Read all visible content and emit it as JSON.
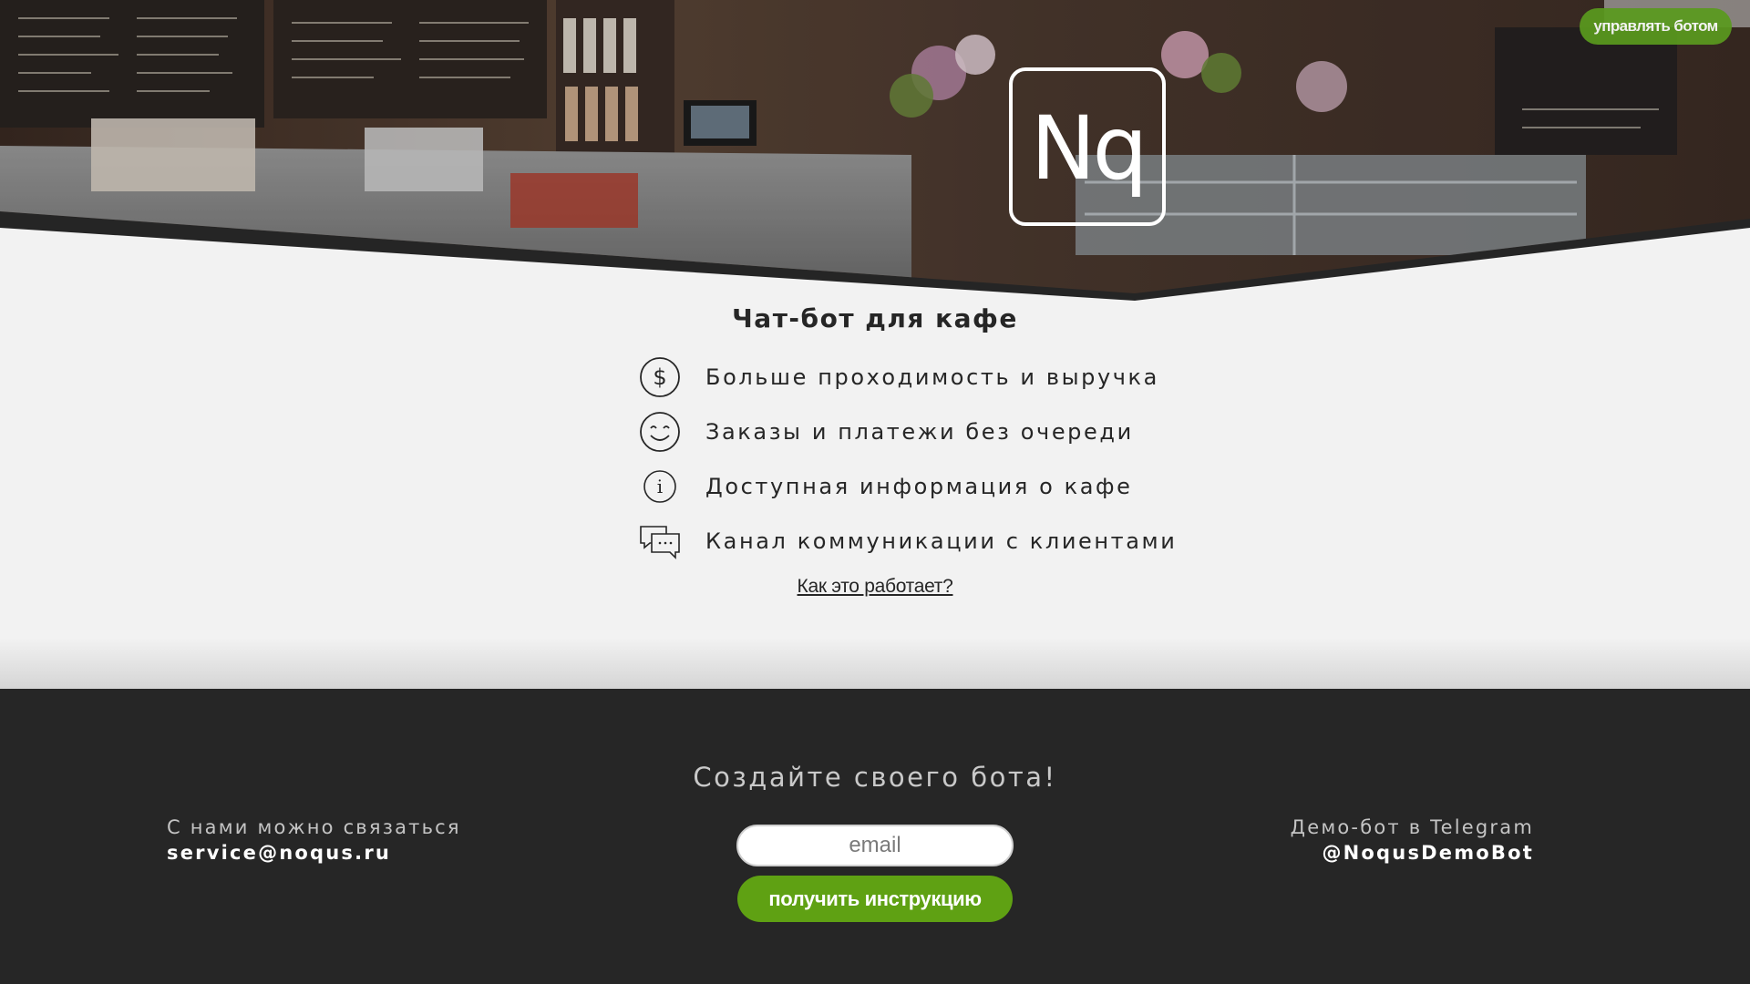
{
  "header": {
    "manage_button_label": "управлять ботом",
    "logo_text": "Nq"
  },
  "main": {
    "title": "Чат-бот для кафе",
    "features": [
      {
        "icon": "dollar-icon",
        "text": "Больше проходимость и выручка"
      },
      {
        "icon": "smile-icon",
        "text": "Заказы и платежи без очереди"
      },
      {
        "icon": "info-icon",
        "text": "Доступная информация о кафе"
      },
      {
        "icon": "chat-bubbles-icon",
        "text": "Канал коммуникации с клиентами"
      }
    ],
    "how_link": "Как это работает?"
  },
  "footer": {
    "cta_title": "Создайте своего бота!",
    "email_placeholder": "email",
    "email_value": "",
    "submit_label": "получить инструкцию",
    "contact": {
      "label": "С нами можно связаться",
      "email": "service@noqus.ru"
    },
    "demo": {
      "label": "Демо-бот в Telegram",
      "handle": "@NoqusDemoBot"
    }
  },
  "colors": {
    "accent_green": "#5fa113",
    "footer_bg": "#262626",
    "page_bg": "#f2f2f2"
  }
}
